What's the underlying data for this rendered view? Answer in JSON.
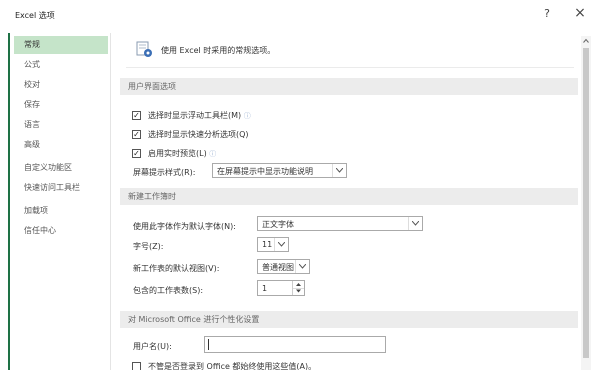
{
  "window": {
    "title": "Excel 选项",
    "help_label": "?",
    "close_label": "×"
  },
  "sidebar": {
    "items": [
      {
        "label": "常规"
      },
      {
        "label": "公式"
      },
      {
        "label": "校对"
      },
      {
        "label": "保存"
      },
      {
        "label": "语言"
      },
      {
        "label": "高级"
      },
      {
        "label": "自定义功能区"
      },
      {
        "label": "快速访问工具栏"
      },
      {
        "label": "加载项"
      },
      {
        "label": "信任中心"
      }
    ],
    "selected": "常规"
  },
  "intro": {
    "text": "使用 Excel 时采用的常规选项。"
  },
  "ui_options": {
    "header": "用户界面选项",
    "checkboxes": [
      {
        "label": "选择时显示浮动工具栏(M)",
        "checked": true,
        "has_info": true
      },
      {
        "label": "选择时显示快速分析选项(Q)",
        "checked": true,
        "has_info": false
      },
      {
        "label": "启用实时预览(L)",
        "checked": true,
        "has_info": true
      }
    ],
    "screentip_label": "屏幕提示样式(R):",
    "screentip_value": "在屏幕提示中显示功能说明",
    "info_glyph": "ⓘ"
  },
  "new_workbook": {
    "header": "新建工作簿时",
    "font_label": "使用此字体作为默认字体(N):",
    "font_value": "正文字体",
    "size_label": "字号(Z):",
    "size_value": "11",
    "view_label": "新工作表的默认视图(V):",
    "view_value": "普通视图",
    "sheets_label": "包含的工作表数(S):",
    "sheets_value": "1"
  },
  "personalize": {
    "header": "对 Microsoft Office 进行个性化设置",
    "username_label": "用户名(U):",
    "username_value": "",
    "always_label": "不管是否登录到 Office 都始终使用这些值(A)。",
    "always_checked": false
  },
  "colors": {
    "accent": "#1e7145",
    "selected_bg": "#c5e4c9",
    "section_bg": "#ececec"
  }
}
